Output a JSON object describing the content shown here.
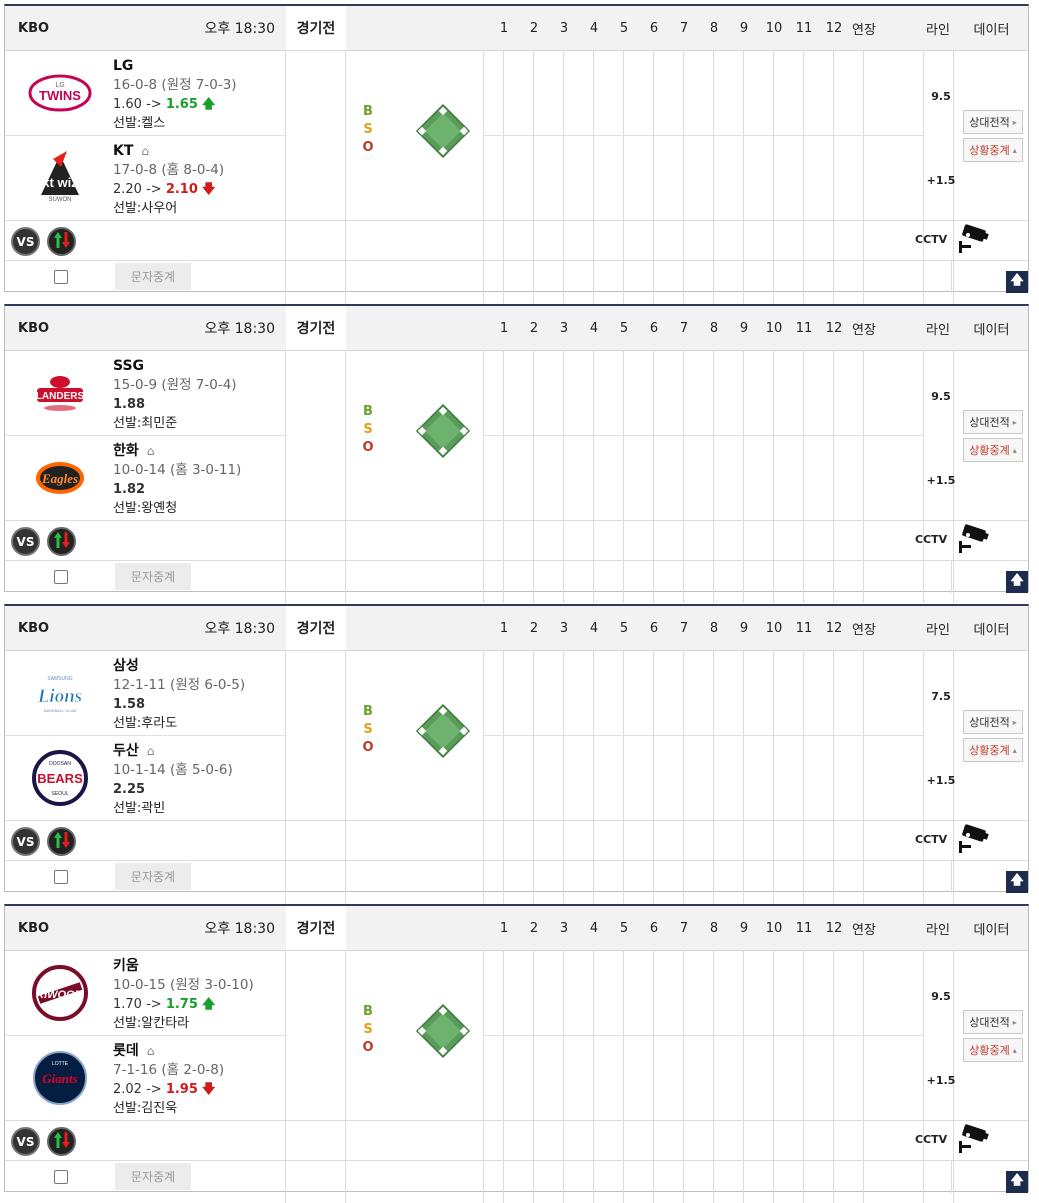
{
  "header": {
    "league": "KBO",
    "status": "경기전",
    "innings": [
      "1",
      "2",
      "3",
      "4",
      "5",
      "6",
      "7",
      "8",
      "9",
      "10",
      "11",
      "12",
      "연장"
    ],
    "line_label": "라인",
    "data_label": "데이터"
  },
  "bso": {
    "b": "B",
    "s": "S",
    "o": "O"
  },
  "buttons": {
    "h2h": "상대전적",
    "live": "상황중계",
    "text_relay": "문자중계",
    "cctv": "CCTV",
    "vs": "VS"
  },
  "games": [
    {
      "time": "오후 18:30",
      "line_over": "9.5",
      "line_handicap": "+1.5",
      "away": {
        "name": "LG",
        "record": "16-0-8 (원정 7-0-3)",
        "odds_from": "1.60",
        "odds_arrow": "->",
        "odds_to": "1.65",
        "trend": "up",
        "starter": "선발:켈스",
        "logo": "lg-twins-logo"
      },
      "home": {
        "name": "KT",
        "record": "17-0-8 (홈 8-0-4)",
        "odds_from": "2.20",
        "odds_arrow": "->",
        "odds_to": "2.10",
        "trend": "down",
        "starter": "선발:사우어",
        "logo": "kt-wiz-logo"
      }
    },
    {
      "time": "오후 18:30",
      "line_over": "9.5",
      "line_handicap": "+1.5",
      "away": {
        "name": "SSG",
        "record": "15-0-9 (원정 7-0-4)",
        "odds_from": "",
        "odds_arrow": "",
        "odds_to": "1.88",
        "trend": "none",
        "starter": "선발:최민준",
        "logo": "ssg-landers-logo"
      },
      "home": {
        "name": "한화",
        "record": "10-0-14 (홈 3-0-11)",
        "odds_from": "",
        "odds_arrow": "",
        "odds_to": "1.82",
        "trend": "none",
        "starter": "선발:왕옌청",
        "logo": "hanwha-eagles-logo"
      }
    },
    {
      "time": "오후 18:30",
      "line_over": "7.5",
      "line_handicap": "+1.5",
      "away": {
        "name": "삼성",
        "record": "12-1-11 (원정 6-0-5)",
        "odds_from": "",
        "odds_arrow": "",
        "odds_to": "1.58",
        "trend": "none",
        "starter": "선발:후라도",
        "logo": "samsung-lions-logo"
      },
      "home": {
        "name": "두산",
        "record": "10-1-14 (홈 5-0-6)",
        "odds_from": "",
        "odds_arrow": "",
        "odds_to": "2.25",
        "trend": "none",
        "starter": "선발:곽빈",
        "logo": "doosan-bears-logo"
      }
    },
    {
      "time": "오후 18:30",
      "line_over": "9.5",
      "line_handicap": "+1.5",
      "away": {
        "name": "키움",
        "record": "10-0-15 (원정 3-0-10)",
        "odds_from": "1.70",
        "odds_arrow": "->",
        "odds_to": "1.75",
        "trend": "up",
        "starter": "선발:알칸타라",
        "logo": "kiwoom-heroes-logo"
      },
      "home": {
        "name": "롯데",
        "record": "7-1-16 (홈 2-0-8)",
        "odds_from": "2.02",
        "odds_arrow": "->",
        "odds_to": "1.95",
        "trend": "down",
        "starter": "선발:김진욱",
        "logo": "lotte-giants-logo"
      }
    }
  ]
}
